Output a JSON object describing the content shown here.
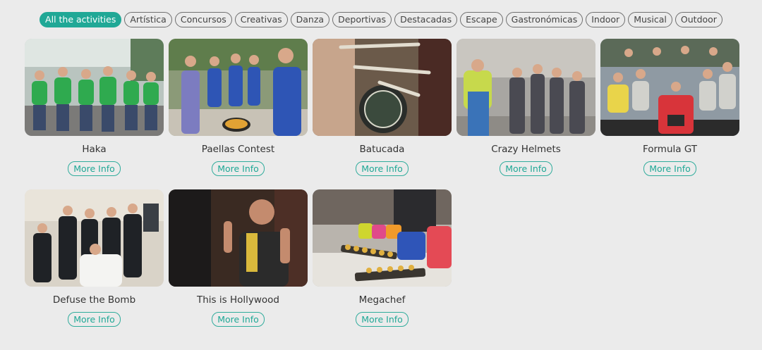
{
  "filters": [
    {
      "label": "All the activities",
      "active": true
    },
    {
      "label": "Artística"
    },
    {
      "label": "Concursos"
    },
    {
      "label": "Creativas"
    },
    {
      "label": "Danza"
    },
    {
      "label": "Deportivas"
    },
    {
      "label": "Destacadas"
    },
    {
      "label": "Escape"
    },
    {
      "label": "Gastronómicas"
    },
    {
      "label": "Indoor"
    },
    {
      "label": "Musical"
    },
    {
      "label": "Outdoor"
    }
  ],
  "more_info_label": "More Info",
  "activities": [
    {
      "title": "Haka",
      "photo_icon": "team-green-shirts-photo"
    },
    {
      "title": "Paellas Contest",
      "photo_icon": "paella-cooking-photo"
    },
    {
      "title": "Batucada",
      "photo_icon": "drum-batucada-photo"
    },
    {
      "title": "Crazy Helmets",
      "photo_icon": "crowd-street-photo"
    },
    {
      "title": "Formula GT",
      "photo_icon": "formula-car-group-photo"
    },
    {
      "title": "Defuse the Bomb",
      "photo_icon": "agents-team-photo"
    },
    {
      "title": "This is Hollywood",
      "photo_icon": "hollywood-actor-photo"
    },
    {
      "title": "Megachef",
      "photo_icon": "food-tray-photo"
    }
  ],
  "theme": {
    "accent": "#20a896",
    "background": "#ebebeb"
  }
}
